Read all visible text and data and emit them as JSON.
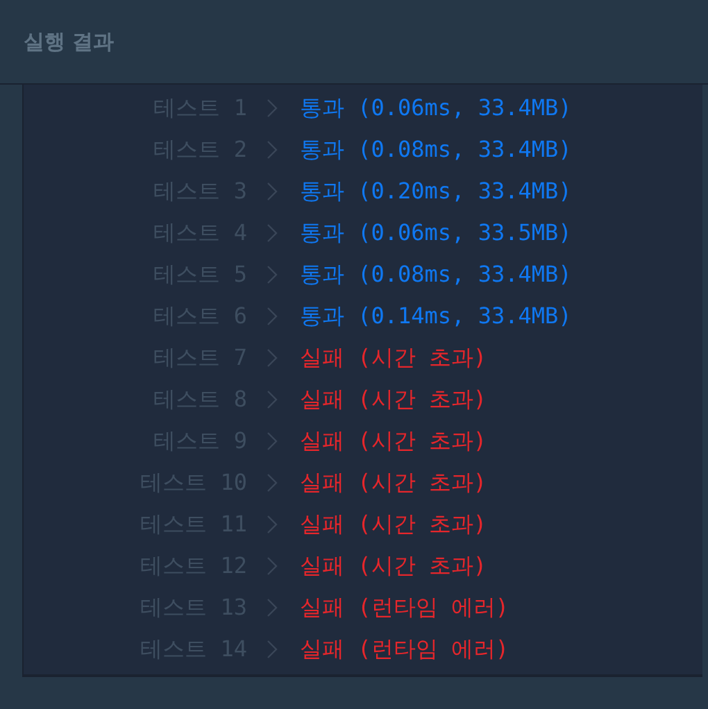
{
  "panel": {
    "title": "실행 결과"
  },
  "tests": [
    {
      "label": "테스트 1",
      "kind": "pass",
      "result": "통과 (0.06ms, 33.4MB)"
    },
    {
      "label": "테스트 2",
      "kind": "pass",
      "result": "통과 (0.08ms, 33.4MB)"
    },
    {
      "label": "테스트 3",
      "kind": "pass",
      "result": "통과 (0.20ms, 33.4MB)"
    },
    {
      "label": "테스트 4",
      "kind": "pass",
      "result": "통과 (0.06ms, 33.5MB)"
    },
    {
      "label": "테스트 5",
      "kind": "pass",
      "result": "통과 (0.08ms, 33.4MB)"
    },
    {
      "label": "테스트 6",
      "kind": "pass",
      "result": "통과 (0.14ms, 33.4MB)"
    },
    {
      "label": "테스트 7",
      "kind": "fail",
      "result": "실패 (시간 초과)"
    },
    {
      "label": "테스트 8",
      "kind": "fail",
      "result": "실패 (시간 초과)"
    },
    {
      "label": "테스트 9",
      "kind": "fail",
      "result": "실패 (시간 초과)"
    },
    {
      "label": "테스트 10",
      "kind": "fail",
      "result": "실패 (시간 초과)"
    },
    {
      "label": "테스트 11",
      "kind": "fail",
      "result": "실패 (시간 초과)"
    },
    {
      "label": "테스트 12",
      "kind": "fail",
      "result": "실패 (시간 초과)"
    },
    {
      "label": "테스트 13",
      "kind": "fail",
      "result": "실패 (런타임 에러)"
    },
    {
      "label": "테스트 14",
      "kind": "fail",
      "result": "실패 (런타임 에러)"
    }
  ]
}
